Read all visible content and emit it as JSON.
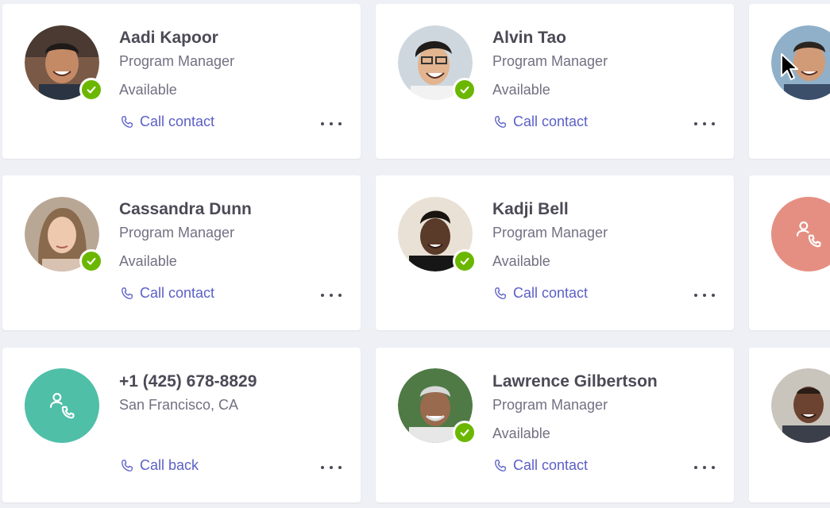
{
  "cards": [
    {
      "name": "Aadi Kapoor",
      "title": "Program Manager",
      "presence": "Available",
      "action": "Call contact"
    },
    {
      "name": "Alvin Tao",
      "title": "Program Manager",
      "presence": "Available",
      "action": "Call contact"
    },
    {
      "name": "Cassandra Dunn",
      "title": "Program Manager",
      "presence": "Available",
      "action": "Call contact"
    },
    {
      "name": "Kadji Bell",
      "title": "Program Manager",
      "presence": "Available",
      "action": "Call contact"
    },
    {
      "name": "+1 (425) 678-8829",
      "title": "San Francisco, CA",
      "action": "Call back"
    },
    {
      "name": "Lawrence Gilbertson",
      "title": "Program Manager",
      "presence": "Available",
      "action": "Call contact"
    }
  ],
  "colors": {
    "background": "#eff0f5",
    "card": "#ffffff",
    "accent": "#5b5fc7",
    "available": "#6bb700",
    "voicemail_teal": "#4fbfa8",
    "voicemail_coral": "#e58f82"
  },
  "icons": {
    "presence": "checkmark-icon",
    "action": "phone-icon",
    "overflow": "more-options-icon",
    "voicemail": "voicemail-icon",
    "cursor": "mouse-pointer-icon"
  }
}
